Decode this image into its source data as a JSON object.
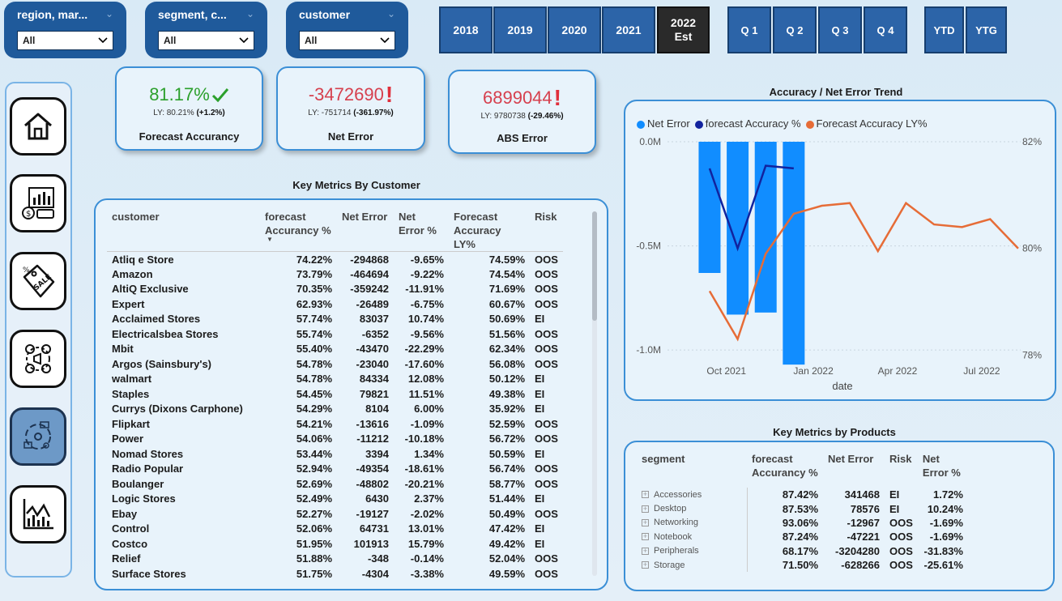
{
  "slicers": [
    {
      "title": "region, mar...",
      "value": "All"
    },
    {
      "title": "segment, c...",
      "value": "All"
    },
    {
      "title": "customer",
      "value": "All"
    }
  ],
  "years": [
    "2018",
    "2019",
    "2020",
    "2021"
  ],
  "active_year": {
    "line1": "2022",
    "line2": "Est"
  },
  "quarters": [
    "Q 1",
    "Q 2",
    "Q 3",
    "Q 4"
  ],
  "periods": [
    "YTD",
    "YTG"
  ],
  "kpis": {
    "accuracy": {
      "value": "81.17%",
      "ly_prefix": "LY: 80.21% ",
      "ly_delta": "(+1.2%)",
      "label": "Forecast Accurancy"
    },
    "net_error": {
      "value": "-3472690",
      "ly_prefix": "LY: -751714 ",
      "ly_delta": "(-361.97%)",
      "label": "Net Error"
    },
    "abs_error": {
      "value": "6899044",
      "ly_prefix": "LY: 9780738 ",
      "ly_delta": "(-29.46%)",
      "label": "ABS Error"
    }
  },
  "customer_table": {
    "title": "Key Metrics By Customer",
    "headers": [
      "customer",
      "forecast Accurancy %",
      "Net Error",
      "Net Error %",
      "Forecast Accuracy LY%",
      "Risk"
    ],
    "rows": [
      [
        "Atliq e Store",
        "74.22%",
        "-294868",
        "-9.65%",
        "74.59%",
        "OOS"
      ],
      [
        "Amazon",
        "73.79%",
        "-464694",
        "-9.22%",
        "74.54%",
        "OOS"
      ],
      [
        "AltiQ Exclusive",
        "70.35%",
        "-359242",
        "-11.91%",
        "71.69%",
        "OOS"
      ],
      [
        "Expert",
        "62.93%",
        "-26489",
        "-6.75%",
        "60.67%",
        "OOS"
      ],
      [
        "Acclaimed Stores",
        "57.74%",
        "83037",
        "10.74%",
        "50.69%",
        "EI"
      ],
      [
        "Electricalsbea Stores",
        "55.74%",
        "-6352",
        "-9.56%",
        "51.56%",
        "OOS"
      ],
      [
        "Mbit",
        "55.40%",
        "-43470",
        "-22.29%",
        "62.34%",
        "OOS"
      ],
      [
        "Argos (Sainsbury's)",
        "54.78%",
        "-23040",
        "-17.60%",
        "56.08%",
        "OOS"
      ],
      [
        "walmart",
        "54.78%",
        "84334",
        "12.08%",
        "50.12%",
        "EI"
      ],
      [
        "Staples",
        "54.45%",
        "79821",
        "11.51%",
        "49.38%",
        "EI"
      ],
      [
        "Currys (Dixons Carphone)",
        "54.29%",
        "8104",
        "6.00%",
        "35.92%",
        "EI"
      ],
      [
        "Flipkart",
        "54.21%",
        "-13616",
        "-1.09%",
        "52.59%",
        "OOS"
      ],
      [
        "Power",
        "54.06%",
        "-11212",
        "-10.18%",
        "56.72%",
        "OOS"
      ],
      [
        "Nomad Stores",
        "53.44%",
        "3394",
        "1.34%",
        "50.59%",
        "EI"
      ],
      [
        "Radio Popular",
        "52.94%",
        "-49354",
        "-18.61%",
        "56.74%",
        "OOS"
      ],
      [
        "Boulanger",
        "52.69%",
        "-48802",
        "-20.21%",
        "58.77%",
        "OOS"
      ],
      [
        "Logic Stores",
        "52.49%",
        "6430",
        "2.37%",
        "51.44%",
        "EI"
      ],
      [
        "Ebay",
        "52.27%",
        "-19127",
        "-2.02%",
        "50.49%",
        "OOS"
      ],
      [
        "Control",
        "52.06%",
        "64731",
        "13.01%",
        "47.42%",
        "EI"
      ],
      [
        "Costco",
        "51.95%",
        "101913",
        "15.79%",
        "49.42%",
        "EI"
      ],
      [
        "Relief",
        "51.88%",
        "-348",
        "-0.14%",
        "52.04%",
        "OOS"
      ],
      [
        "Surface Stores",
        "51.75%",
        "-4304",
        "-3.38%",
        "49.59%",
        "OOS"
      ]
    ]
  },
  "product_table": {
    "title": "Key Metrics by Products",
    "headers": [
      "segment",
      "forecast Accurancy %",
      "Net Error",
      "Risk",
      "Net Error %"
    ],
    "rows": [
      [
        "Accessories",
        "87.42%",
        "341468",
        "EI",
        "1.72%"
      ],
      [
        "Desktop",
        "87.53%",
        "78576",
        "EI",
        "10.24%"
      ],
      [
        "Networking",
        "93.06%",
        "-12967",
        "OOS",
        "-1.69%"
      ],
      [
        "Notebook",
        "87.24%",
        "-47221",
        "OOS",
        "-1.69%"
      ],
      [
        "Peripherals",
        "68.17%",
        "-3204280",
        "OOS",
        "-31.83%"
      ],
      [
        "Storage",
        "71.50%",
        "-628266",
        "OOS",
        "-25.61%"
      ]
    ]
  },
  "chart_data": {
    "type": "bar",
    "title": "Accuracy / Net Error Trend",
    "xlabel": "date",
    "x_ticks": [
      "Oct 2021",
      "Jan 2022",
      "Apr 2022",
      "Jul 2022"
    ],
    "y_left_ticks": [
      "0.0M",
      "-0.5M",
      "-1.0M"
    ],
    "y_right_ticks": [
      "82%",
      "80%",
      "78%"
    ],
    "ylim_left": [
      -1.05,
      0.0
    ],
    "ylim_right": [
      77.9,
      82.0
    ],
    "legend": [
      "Net Error",
      "forecast Accuracy %",
      "Forecast Accuracy LY%"
    ],
    "colors": {
      "net_error": "#118dff",
      "accuracy": "#12239e",
      "accuracy_ly": "#e66c37"
    },
    "net_error_bars": [
      {
        "x": "2021-09",
        "value": -0.63
      },
      {
        "x": "2021-10",
        "value": -0.83
      },
      {
        "x": "2021-11",
        "value": -0.82
      },
      {
        "x": "2021-12",
        "value": -1.07
      }
    ],
    "accuracy_series": [
      {
        "x": "2021-09",
        "value": 81.5
      },
      {
        "x": "2021-10",
        "value": 80.0
      },
      {
        "x": "2021-11",
        "value": 81.55
      },
      {
        "x": "2021-12",
        "value": 81.5
      }
    ],
    "accuracy_ly_series": [
      {
        "x": "2021-09",
        "value": 79.2
      },
      {
        "x": "2021-10",
        "value": 78.3
      },
      {
        "x": "2021-11",
        "value": 79.9
      },
      {
        "x": "2021-12",
        "value": 80.65
      },
      {
        "x": "2022-01",
        "value": 80.8
      },
      {
        "x": "2022-02",
        "value": 80.85
      },
      {
        "x": "2022-03",
        "value": 79.95
      },
      {
        "x": "2022-04",
        "value": 80.85
      },
      {
        "x": "2022-05",
        "value": 80.45
      },
      {
        "x": "2022-06",
        "value": 80.4
      },
      {
        "x": "2022-07",
        "value": 80.55
      },
      {
        "x": "2022-08",
        "value": 80.0
      }
    ]
  }
}
